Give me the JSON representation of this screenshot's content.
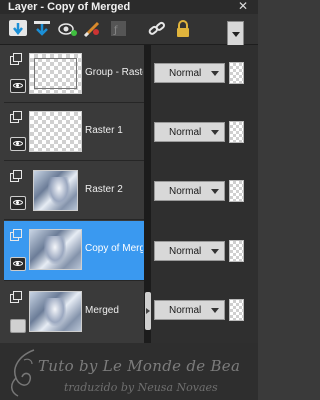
{
  "window": {
    "title": "Layer - Copy of Merged",
    "close_icon": "close-icon"
  },
  "toolbar": {
    "icons": [
      "new-raster-layer-icon",
      "new-layer-from-selection-icon",
      "toggle-visibility-icon",
      "edit-mask-icon",
      "disabled-link-icon",
      "link-icon",
      "lock-icon"
    ],
    "menu_icon": "chevron-down-icon"
  },
  "layers": [
    {
      "name": "Group - Raster",
      "blend_mode": "Normal",
      "visible": true,
      "selected": false,
      "thumb": "frame"
    },
    {
      "name": "Raster 1",
      "blend_mode": "Normal",
      "visible": true,
      "selected": false,
      "thumb": "transparent"
    },
    {
      "name": "Raster 2",
      "blend_mode": "Normal",
      "visible": true,
      "selected": false,
      "thumb": "art"
    },
    {
      "name": "Copy of Merged",
      "blend_mode": "Normal",
      "visible": true,
      "selected": true,
      "thumb": "art"
    },
    {
      "name": "Merged",
      "blend_mode": "Normal",
      "visible": false,
      "selected": false,
      "thumb": "art"
    }
  ],
  "watermark": {
    "line1": "Tuto by Le Monde de Bea",
    "line2": "traduzido by Neusa Novaes"
  },
  "colors": {
    "selected": "#3a99f0",
    "panel": "#3a3a3a"
  }
}
